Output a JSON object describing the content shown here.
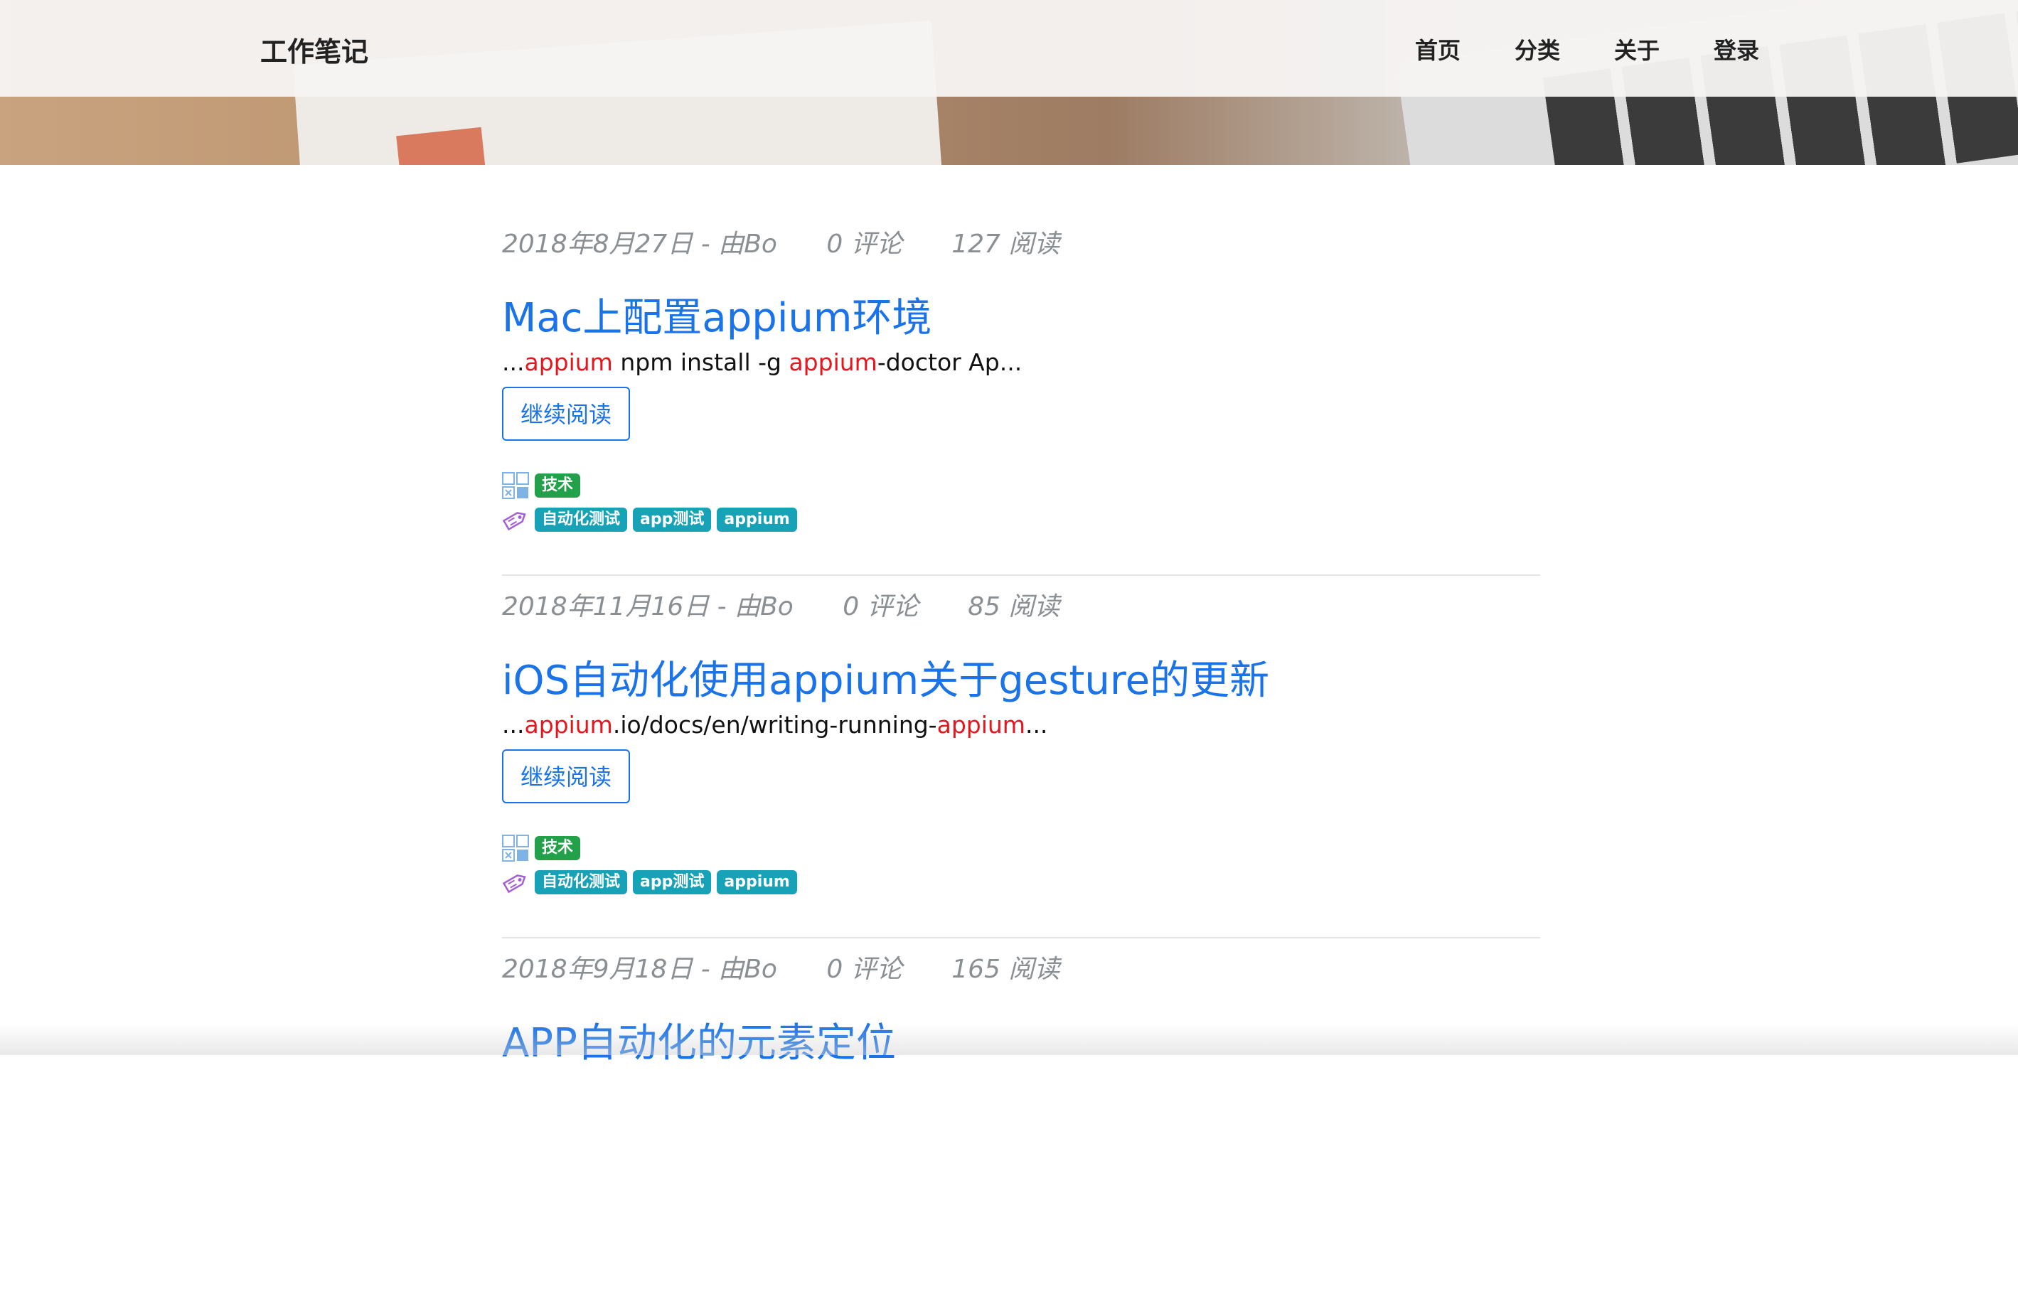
{
  "brand": "工作笔记",
  "nav": [
    "首页",
    "分类",
    "关于",
    "登录"
  ],
  "read_more_label": "继续阅读",
  "category_icon": "category-grid-icon",
  "tag_icon": "tag-icon",
  "colors": {
    "link": "#1a73e8",
    "highlight": "#e5161d",
    "category_badge": "#22a04a",
    "tag_badge": "#17a2b8",
    "meta": "#8a8f94"
  },
  "posts": [
    {
      "date": "2018年8月27日 - 由Bo",
      "comments": "0 评论",
      "reads": "127 阅读",
      "title": "Mac上配置appium环境",
      "excerpt": [
        {
          "t": "...",
          "hl": false
        },
        {
          "t": "appium",
          "hl": true
        },
        {
          "t": " npm install -g ",
          "hl": false
        },
        {
          "t": "appium",
          "hl": true
        },
        {
          "t": "-doctor Ap...",
          "hl": false
        }
      ],
      "category": "技术",
      "tags": [
        "自动化测试",
        "app测试",
        "appium"
      ]
    },
    {
      "date": "2018年11月16日 - 由Bo",
      "comments": "0 评论",
      "reads": "85 阅读",
      "title": "iOS自动化使用appium关于gesture的更新",
      "excerpt": [
        {
          "t": "...",
          "hl": false
        },
        {
          "t": "appium",
          "hl": true
        },
        {
          "t": ".io/docs/en/writing-running-",
          "hl": false
        },
        {
          "t": "appium",
          "hl": true
        },
        {
          "t": "...",
          "hl": false
        }
      ],
      "category": "技术",
      "tags": [
        "自动化测试",
        "app测试",
        "appium"
      ]
    },
    {
      "date": "2018年9月18日 - 由Bo",
      "comments": "0 评论",
      "reads": "165 阅读",
      "title": "APP自动化的元素定位"
    }
  ]
}
